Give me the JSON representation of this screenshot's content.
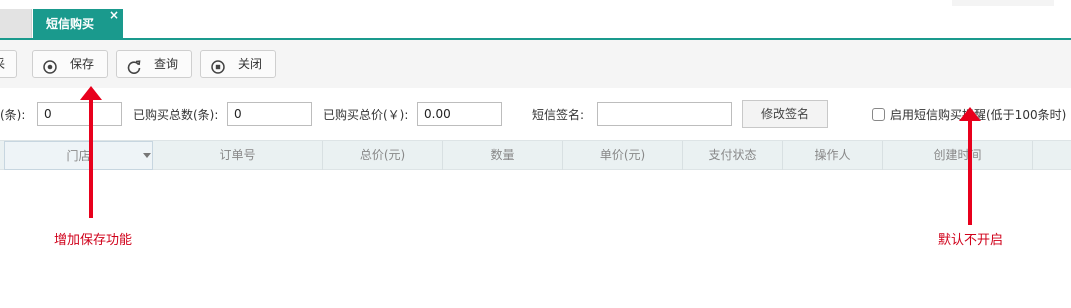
{
  "tabs": {
    "active_label": "短信购买",
    "close_glyph": "×",
    "active_color": "#1a9a8d"
  },
  "toolbar": {
    "cut_label": "采",
    "save_label": "保存",
    "query_label": "查询",
    "close_label": "关闭"
  },
  "form": {
    "count_label": "(条):",
    "count_value": "0",
    "total_count_label": "已购买总数(条):",
    "total_count_value": "0",
    "total_price_label": "已购买总价(￥):",
    "total_price_value": "0.00",
    "signature_label": "短信签名:",
    "signature_value": "",
    "modify_signature_label": "修改签名",
    "reminder_label": "启用短信购买提醒(低于100条时)",
    "reminder_checked": false
  },
  "grid": {
    "columns": [
      "门店",
      "订单号",
      "总价(元)",
      "数量",
      "单价(元)",
      "支付状态",
      "操作人",
      "创建时间"
    ]
  },
  "annotations": {
    "left_note": "增加保存功能",
    "right_note": "默认不开启",
    "note_color": "#d0001a"
  }
}
